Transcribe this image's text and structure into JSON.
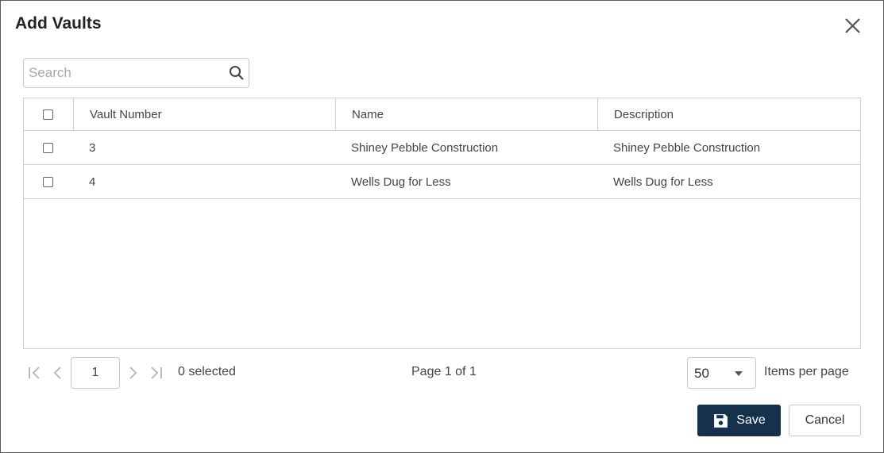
{
  "dialog": {
    "title": "Add Vaults"
  },
  "search": {
    "placeholder": "Search"
  },
  "table": {
    "columns": [
      "Vault Number",
      "Name",
      "Description"
    ],
    "rows": [
      {
        "vault_number": "3",
        "name": "Shiney Pebble Construction",
        "description": "Shiney Pebble Construction"
      },
      {
        "vault_number": "4",
        "name": "Wells Dug for Less",
        "description": "Wells Dug for Less"
      }
    ]
  },
  "pager": {
    "current_page": "1",
    "selected_text": "0 selected",
    "page_info": "Page 1 of 1",
    "items_per_page": "50",
    "items_per_page_label": "Items per page"
  },
  "actions": {
    "save_label": "Save",
    "cancel_label": "Cancel"
  },
  "colors": {
    "primary": "#15314b",
    "border": "#d0d0d0"
  }
}
